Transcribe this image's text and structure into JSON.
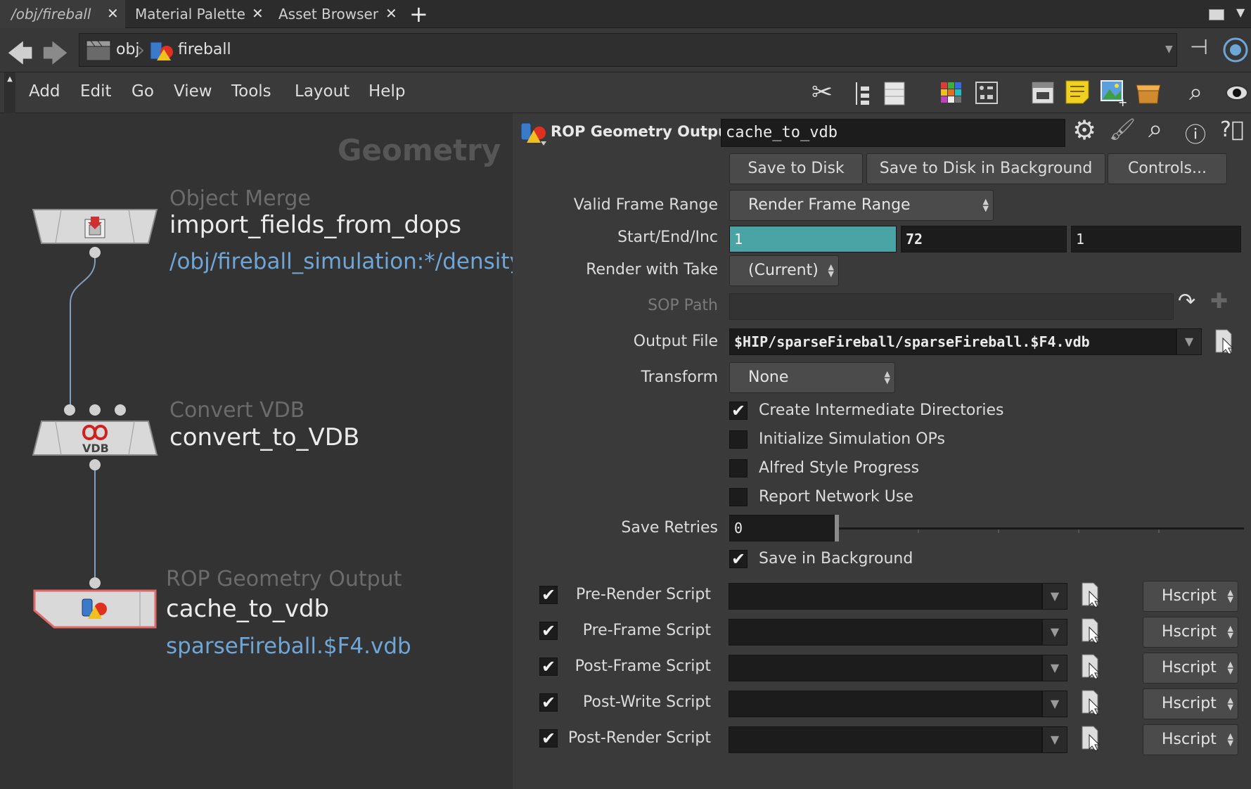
{
  "tabs": [
    {
      "label": "/obj/fireball"
    },
    {
      "label": "Material Palette"
    },
    {
      "label": "Asset Browser"
    }
  ],
  "path": {
    "segments": [
      {
        "label": "obj"
      },
      {
        "label": "fireball"
      }
    ]
  },
  "menu": {
    "items": [
      "Add",
      "Edit",
      "Go",
      "View",
      "Tools",
      "Layout",
      "Help"
    ]
  },
  "network": {
    "context_label": "Geometry",
    "nodes": [
      {
        "type": "Object Merge",
        "name": "import_fields_from_dops",
        "sub": "/obj/fireball_simulation:*/density"
      },
      {
        "type": "Convert VDB",
        "name": "convert_to_VDB",
        "sub": ""
      },
      {
        "type": "ROP Geometry Output",
        "name": "cache_to_vdb",
        "sub": "sparseFireball.$F4.vdb"
      }
    ]
  },
  "parms": {
    "node_type": "ROP Geometry Output",
    "node_name": "cache_to_vdb",
    "buttons": {
      "save_to_disk": "Save to Disk",
      "save_bg": "Save to Disk in Background",
      "controls": "Controls..."
    },
    "valid_frame_range": {
      "label": "Valid Frame Range",
      "value": "Render Frame Range"
    },
    "start_end_inc": {
      "label": "Start/End/Inc",
      "start": "1",
      "end": "72",
      "inc": "1"
    },
    "render_with_take": {
      "label": "Render with Take",
      "value": "(Current)"
    },
    "sop_path": {
      "label": "SOP Path",
      "value": ""
    },
    "output_file": {
      "label": "Output File",
      "value": "$HIP/sparseFireball/sparseFireball.$F4.vdb"
    },
    "transform": {
      "label": "Transform",
      "value": "None"
    },
    "toggles": [
      {
        "label": "Create Intermediate Directories",
        "checked": true
      },
      {
        "label": "Initialize Simulation OPs",
        "checked": false
      },
      {
        "label": "Alfred Style Progress",
        "checked": false
      },
      {
        "label": "Report Network Use",
        "checked": false
      }
    ],
    "save_retries": {
      "label": "Save Retries",
      "value": "0"
    },
    "save_in_background": {
      "label": "Save in Background",
      "checked": true
    },
    "scripts": [
      {
        "label": "Pre-Render Script",
        "enabled": true,
        "value": "",
        "lang": "Hscript"
      },
      {
        "label": "Pre-Frame Script",
        "enabled": true,
        "value": "",
        "lang": "Hscript"
      },
      {
        "label": "Post-Frame Script",
        "enabled": true,
        "value": "",
        "lang": "Hscript"
      },
      {
        "label": "Post-Write Script",
        "enabled": true,
        "value": "",
        "lang": "Hscript"
      },
      {
        "label": "Post-Render Script",
        "enabled": true,
        "value": "",
        "lang": "Hscript"
      }
    ]
  },
  "colors": {
    "accent_field": "#4aa3a4",
    "link_blue": "#6fa6d8",
    "panel_bg": "#3a3a3a",
    "network_bg": "#333333"
  }
}
